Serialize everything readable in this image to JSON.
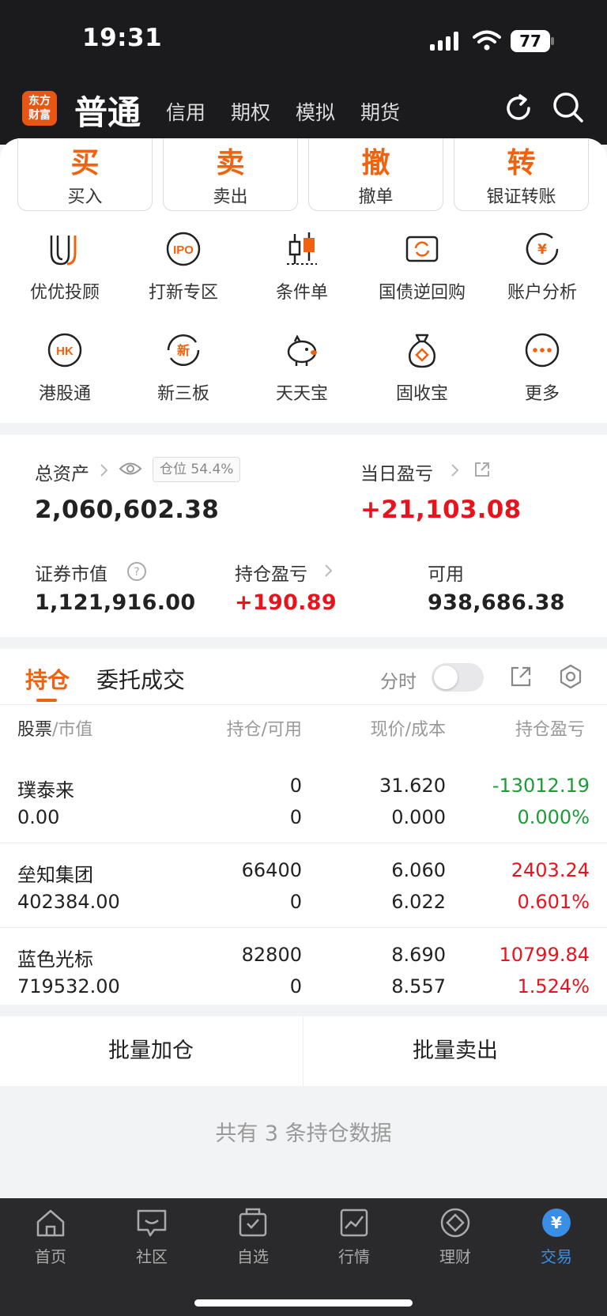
{
  "status_bar": {
    "time": "19:31",
    "battery": "77"
  },
  "nav": {
    "logo": [
      "东方",
      "财富"
    ],
    "active_tab": "普通",
    "tabs": [
      "信用",
      "期权",
      "模拟",
      "期货"
    ]
  },
  "actions": [
    {
      "big": "买",
      "label": "买入"
    },
    {
      "big": "卖",
      "label": "卖出"
    },
    {
      "big": "撤",
      "label": "撤单"
    },
    {
      "big": "转",
      "label": "银证转账"
    }
  ],
  "features_row1": [
    {
      "label": "优优投顾",
      "icon": "uu-icon"
    },
    {
      "label": "打新专区",
      "icon": "ipo-icon"
    },
    {
      "label": "条件单",
      "icon": "candlestick-icon"
    },
    {
      "label": "国债逆回购",
      "icon": "repo-icon"
    },
    {
      "label": "账户分析",
      "icon": "account-analysis-icon"
    }
  ],
  "features_row2": [
    {
      "label": "港股通",
      "icon": "hk-icon"
    },
    {
      "label": "新三板",
      "icon": "new-board-icon"
    },
    {
      "label": "天天宝",
      "icon": "piggy-bank-icon"
    },
    {
      "label": "固收宝",
      "icon": "money-bag-icon"
    },
    {
      "label": "更多",
      "icon": "more-icon"
    }
  ],
  "assets": {
    "total_label": "总资产",
    "position_ratio": "仓位 54.4%",
    "total_value": "2,060,602.38",
    "daily_pl_label": "当日盈亏",
    "daily_pl_value": "+21,103.08",
    "market_value_label": "证券市值",
    "market_value": "1,121,916.00",
    "holding_pl_label": "持仓盈亏",
    "holding_pl_value": "+190.89",
    "available_label": "可用",
    "available_value": "938,686.38"
  },
  "positions": {
    "tab_active": "持仓",
    "tab_other": "委托成交",
    "timeshare_label": "分时",
    "headers": {
      "c1a": "股票",
      "c1b": "/市值",
      "c2a": "持仓",
      "c2b": "/可用",
      "c3a": "现价",
      "c3b": "/成本",
      "c4": "持仓盈亏"
    },
    "rows": [
      {
        "name": "璞泰来",
        "mv": "0.00",
        "qty": "0",
        "avail": "0",
        "price": "31.620",
        "cost": "0.000",
        "pl": "-13012.19",
        "pct": "0.000%",
        "dir": "down"
      },
      {
        "name": "垒知集团",
        "mv": "402384.00",
        "qty": "66400",
        "avail": "0",
        "price": "6.060",
        "cost": "6.022",
        "pl": "2403.24",
        "pct": "0.601%",
        "dir": "up"
      },
      {
        "name": "蓝色光标",
        "mv": "719532.00",
        "qty": "82800",
        "avail": "0",
        "price": "8.690",
        "cost": "8.557",
        "pl": "10799.84",
        "pct": "1.524%",
        "dir": "up"
      }
    ]
  },
  "batch": {
    "add": "批量加仓",
    "sell": "批量卖出"
  },
  "footer_text": "共有 3 条持仓数据",
  "bottom_nav": [
    {
      "label": "首页",
      "icon": "home-icon"
    },
    {
      "label": "社区",
      "icon": "community-icon"
    },
    {
      "label": "自选",
      "icon": "watchlist-icon"
    },
    {
      "label": "行情",
      "icon": "market-icon"
    },
    {
      "label": "理财",
      "icon": "wealth-icon"
    },
    {
      "label": "交易",
      "icon": "trade-icon",
      "active": true
    }
  ],
  "colors": {
    "accent": "#f0620f",
    "up": "#e8141d",
    "down": "#1f9a38",
    "active_nav": "#3a8ee6"
  }
}
